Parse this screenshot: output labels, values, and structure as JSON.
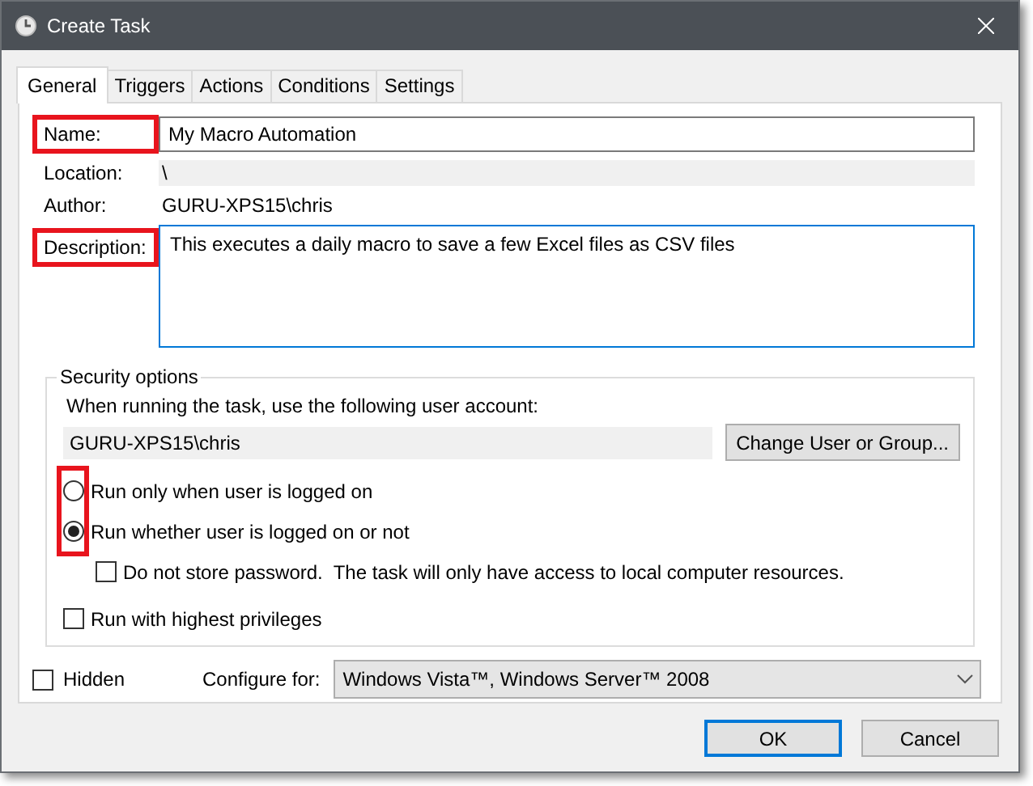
{
  "window": {
    "title": "Create Task"
  },
  "tabs": [
    {
      "label": "General",
      "selected": true
    },
    {
      "label": "Triggers",
      "selected": false
    },
    {
      "label": "Actions",
      "selected": false
    },
    {
      "label": "Conditions",
      "selected": false
    },
    {
      "label": "Settings",
      "selected": false
    }
  ],
  "fields": [
    {
      "kind": "input",
      "label": "Name:",
      "value": "My Macro Automation",
      "highlighted": true
    },
    {
      "kind": "readonly",
      "label": "Location:",
      "value": "\\",
      "highlighted": false
    },
    {
      "kind": "text",
      "label": "Author:",
      "value": "GURU-XPS15\\chris",
      "highlighted": false
    },
    {
      "kind": "textarea",
      "label": "Description:",
      "value": "This executes a daily macro to save a few Excel files as CSV files",
      "highlighted": true
    }
  ],
  "security": {
    "title": "Security options",
    "prompt": "When running the task, use the following user account:",
    "account": "GURU-XPS15\\chris",
    "change_button": "Change User or Group...",
    "run_options_highlighted": true,
    "run_options": [
      {
        "label": "Run only when user is logged on",
        "selected": false
      },
      {
        "label": "Run whether user is logged on or not",
        "selected": true
      }
    ],
    "do_not_store_password": {
      "label": "Do not store password.  The task will only have access to local computer resources.",
      "checked": false
    },
    "highest_privileges": {
      "label": "Run with highest privileges",
      "checked": false
    }
  },
  "hidden": {
    "label": "Hidden",
    "checked": false
  },
  "configure": {
    "label": "Configure for:",
    "value": "Windows Vista™, Windows Server™ 2008"
  },
  "buttons": [
    {
      "label": "OK",
      "default": true
    },
    {
      "label": "Cancel",
      "default": false
    }
  ]
}
